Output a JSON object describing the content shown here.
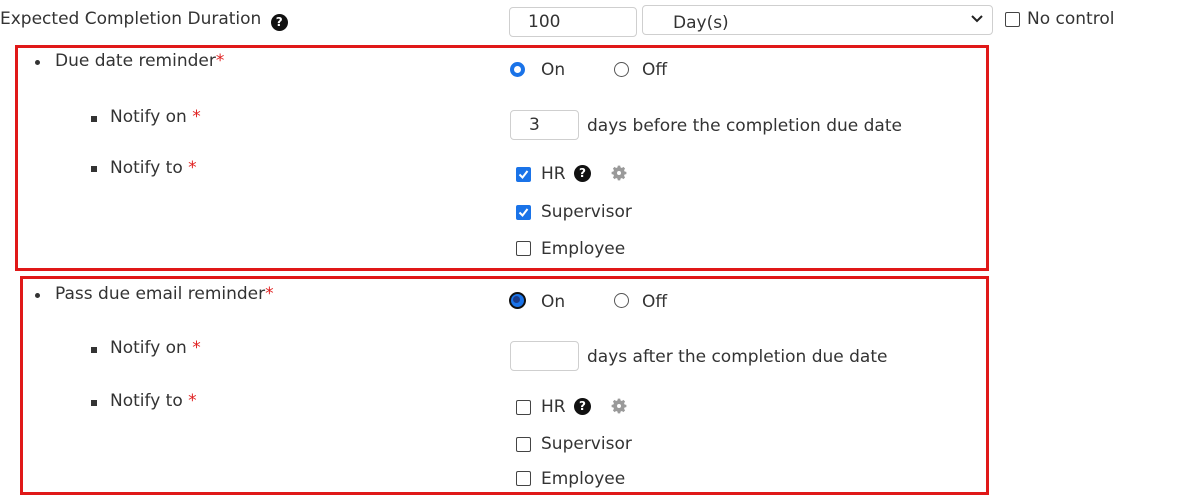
{
  "expected": {
    "label": "Expected Completion Duration",
    "value": "100",
    "unit_selected": "Day(s)",
    "no_control_label": "No control"
  },
  "due_reminder": {
    "title": "Due date reminder",
    "required_mark": "*",
    "on_label": "On",
    "off_label": "Off",
    "selected": "On",
    "notify_on_label": "Notify on",
    "days_value": "3",
    "days_suffix": "days before the completion due date",
    "notify_to_label": "Notify to",
    "recipients": [
      {
        "label": "HR",
        "checked": true
      },
      {
        "label": "Supervisor",
        "checked": true
      },
      {
        "label": "Employee",
        "checked": false
      }
    ]
  },
  "pass_due_reminder": {
    "title": "Pass due email reminder",
    "required_mark": "*",
    "on_label": "On",
    "off_label": "Off",
    "selected": "On",
    "notify_on_label": "Notify on",
    "days_value": "",
    "days_suffix": "days after the completion due date",
    "notify_to_label": "Notify to",
    "recipients": [
      {
        "label": "HR",
        "checked": false
      },
      {
        "label": "Supervisor",
        "checked": false
      },
      {
        "label": "Employee",
        "checked": false
      }
    ]
  },
  "icons": {
    "help": "question-circle-icon",
    "settings": "gear-icon",
    "dropdown": "chevron-down-icon"
  },
  "colors": {
    "highlight_border": "#e01818",
    "required": "#e02020",
    "checked": "#1a73e8"
  }
}
